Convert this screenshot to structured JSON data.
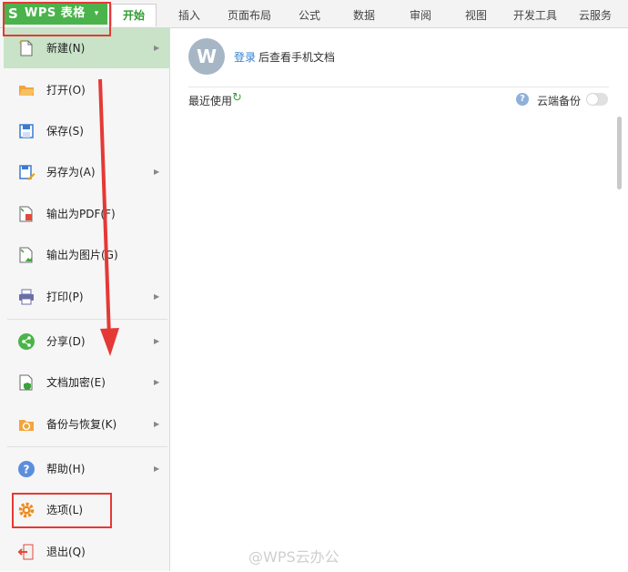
{
  "app": {
    "logo": "S",
    "title": "WPS 表格",
    "caret": "▾"
  },
  "ribbon": {
    "tabs": [
      "开始",
      "插入",
      "页面布局",
      "公式",
      "数据",
      "审阅",
      "视图",
      "开发工具",
      "云服务"
    ],
    "active_tab": "开始"
  },
  "menu": {
    "items": [
      {
        "label": "新建(N)",
        "icon": "new-file-icon",
        "has_submenu": true,
        "active": true
      },
      {
        "label": "打开(O)",
        "icon": "folder-open-icon",
        "has_submenu": false
      },
      {
        "label": "保存(S)",
        "icon": "save-icon",
        "has_submenu": false
      },
      {
        "label": "另存为(A)",
        "icon": "save-as-icon",
        "has_submenu": true
      },
      {
        "label": "输出为PDF(F)",
        "icon": "pdf-icon",
        "has_submenu": false
      },
      {
        "label": "输出为图片(G)",
        "icon": "image-export-icon",
        "has_submenu": false
      },
      {
        "label": "打印(P)",
        "icon": "printer-icon",
        "has_submenu": true
      },
      {
        "label": "分享(D)",
        "icon": "share-icon",
        "has_submenu": true
      },
      {
        "label": "文档加密(E)",
        "icon": "lock-document-icon",
        "has_submenu": true
      },
      {
        "label": "备份与恢复(K)",
        "icon": "backup-restore-icon",
        "has_submenu": true
      },
      {
        "label": "帮助(H)",
        "icon": "help-icon",
        "has_submenu": true
      },
      {
        "label": "选项(L)",
        "icon": "gear-icon",
        "has_submenu": false
      },
      {
        "label": "退出(Q)",
        "icon": "exit-icon",
        "has_submenu": false
      }
    ],
    "arrow": "▶"
  },
  "content": {
    "avatar_letter": "W",
    "login_link": "登录",
    "login_hint": "后查看手机文档",
    "recent_label": "最近使用",
    "refresh_glyph": "↻",
    "help_glyph": "?",
    "cloud_backup_label": "云端备份",
    "cloud_backup_enabled": false
  },
  "watermark": "@WPS云办公",
  "colors": {
    "brand_green": "#4bb34b",
    "active_menu": "#c8e3c8",
    "link_blue": "#2f7fd1",
    "annotation_red": "#e53935"
  }
}
